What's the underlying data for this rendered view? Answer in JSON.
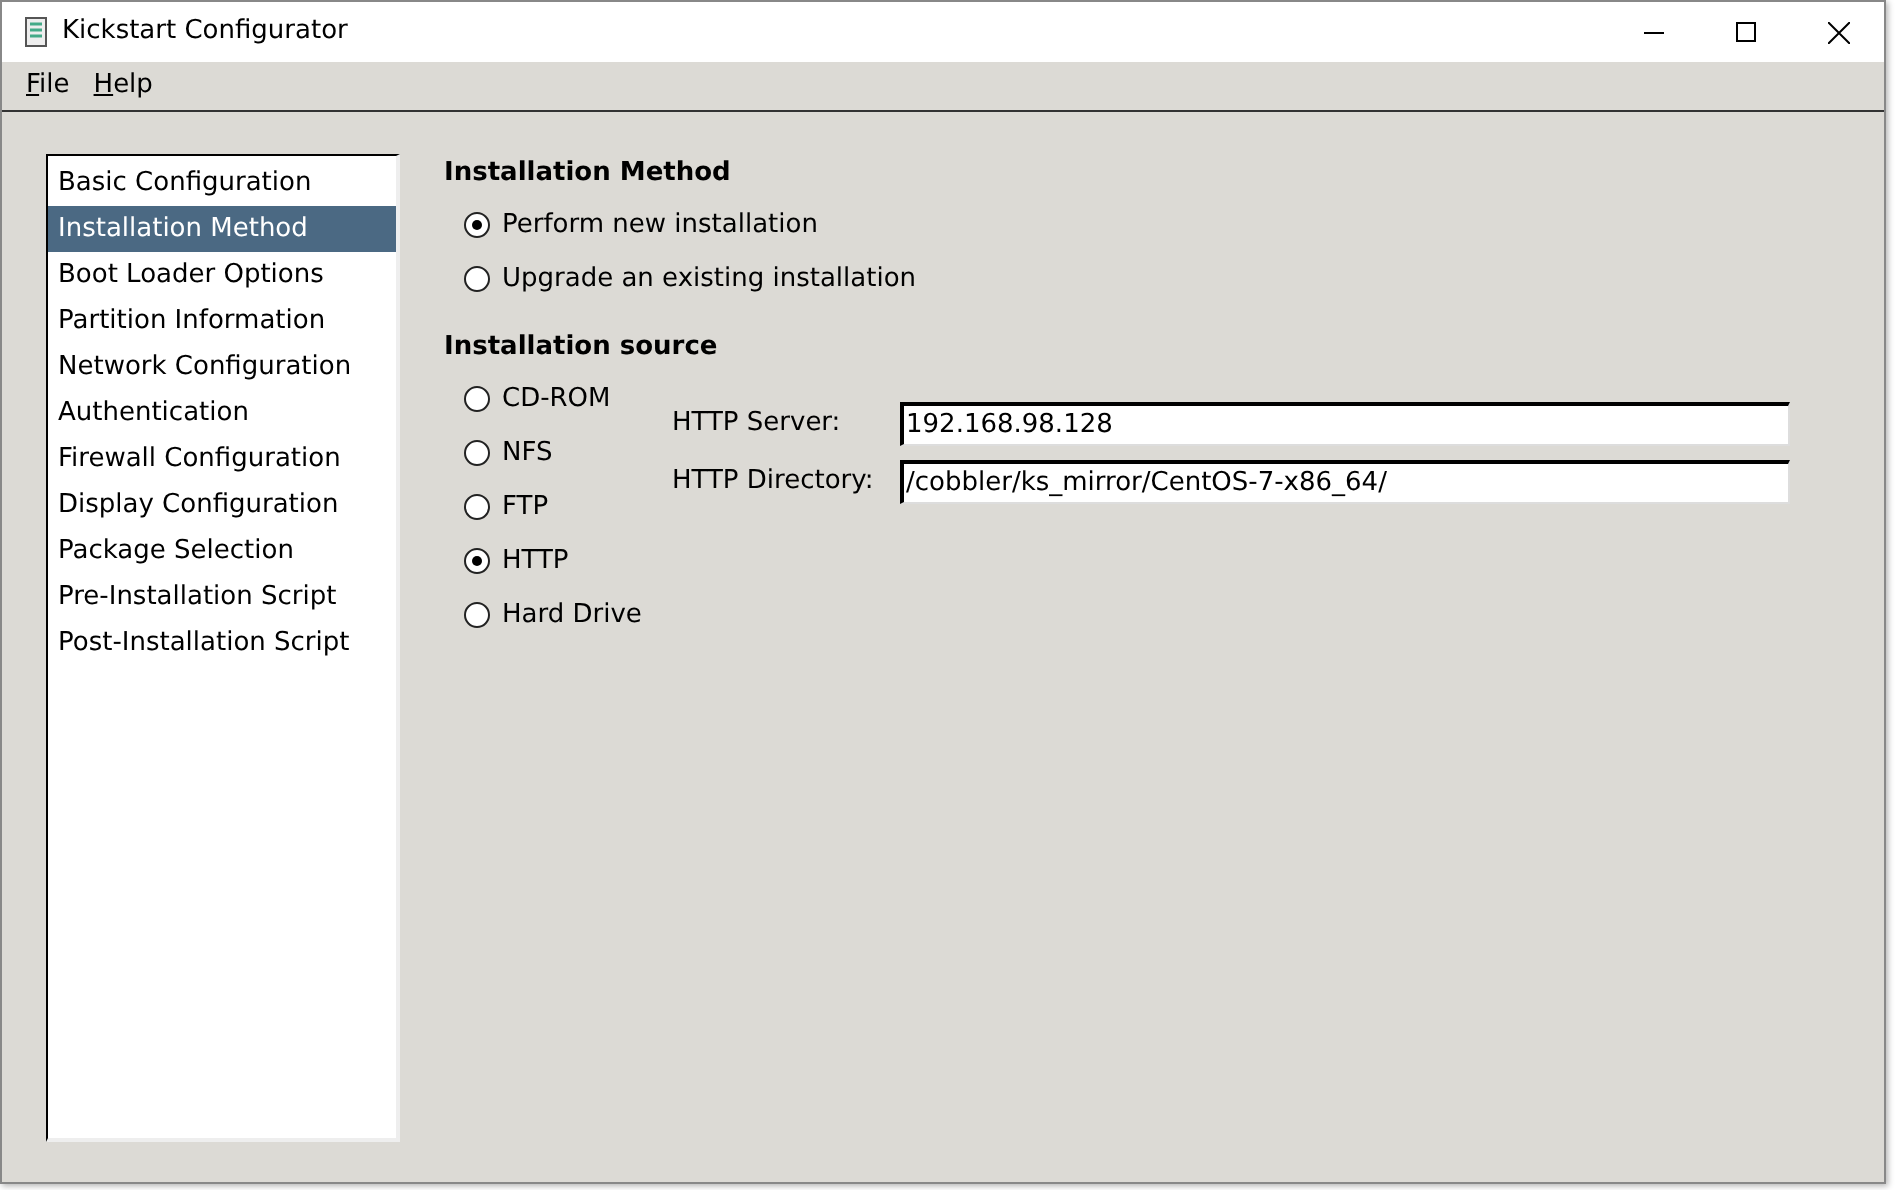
{
  "window": {
    "title": "Kickstart Configurator"
  },
  "menu": [
    "File",
    "Help"
  ],
  "sidebar": {
    "items": [
      {
        "label": "Basic Configuration",
        "selected": false
      },
      {
        "label": "Installation Method",
        "selected": true
      },
      {
        "label": "Boot Loader Options",
        "selected": false
      },
      {
        "label": "Partition Information",
        "selected": false
      },
      {
        "label": "Network Configuration",
        "selected": false
      },
      {
        "label": "Authentication",
        "selected": false
      },
      {
        "label": "Firewall Configuration",
        "selected": false
      },
      {
        "label": "Display Configuration",
        "selected": false
      },
      {
        "label": "Package Selection",
        "selected": false
      },
      {
        "label": "Pre-Installation Script",
        "selected": false
      },
      {
        "label": "Post-Installation Script",
        "selected": false
      }
    ]
  },
  "installation_method": {
    "heading": "Installation Method",
    "options": [
      {
        "label": "Perform new installation",
        "selected": true
      },
      {
        "label": "Upgrade an existing installation",
        "selected": false
      }
    ]
  },
  "installation_source": {
    "heading": "Installation source",
    "options": [
      {
        "label": "CD-ROM",
        "selected": false
      },
      {
        "label": "NFS",
        "selected": false
      },
      {
        "label": "FTP",
        "selected": false
      },
      {
        "label": "HTTP",
        "selected": true
      },
      {
        "label": "Hard Drive",
        "selected": false
      }
    ],
    "fields": [
      {
        "label": "HTTP Server:",
        "value": "192.168.98.128"
      },
      {
        "label": "HTTP Directory:",
        "value": "/cobbler/ks_mirror/CentOS-7-x86_64/"
      }
    ]
  }
}
